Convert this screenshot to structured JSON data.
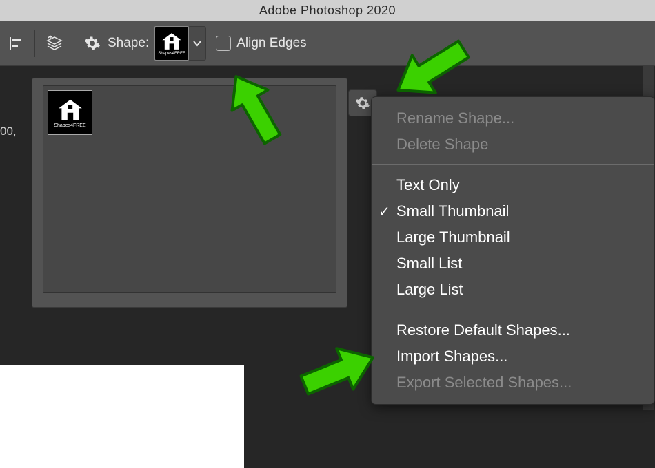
{
  "titlebar": {
    "title": "Adobe Photoshop 2020"
  },
  "toolbar": {
    "shape_label": "Shape:",
    "shape_micro": "Shapes4FREE",
    "align_edges_label": "Align Edges"
  },
  "left_stub": "00,",
  "panel": {
    "thumb_micro": "Shapes4FREE"
  },
  "menu": {
    "rename": "Rename Shape...",
    "delete": "Delete Shape",
    "text_only": "Text Only",
    "small_thumb": "Small Thumbnail",
    "large_thumb": "Large Thumbnail",
    "small_list": "Small List",
    "large_list": "Large List",
    "restore": "Restore Default Shapes...",
    "import": "Import Shapes...",
    "export": "Export Selected Shapes..."
  }
}
